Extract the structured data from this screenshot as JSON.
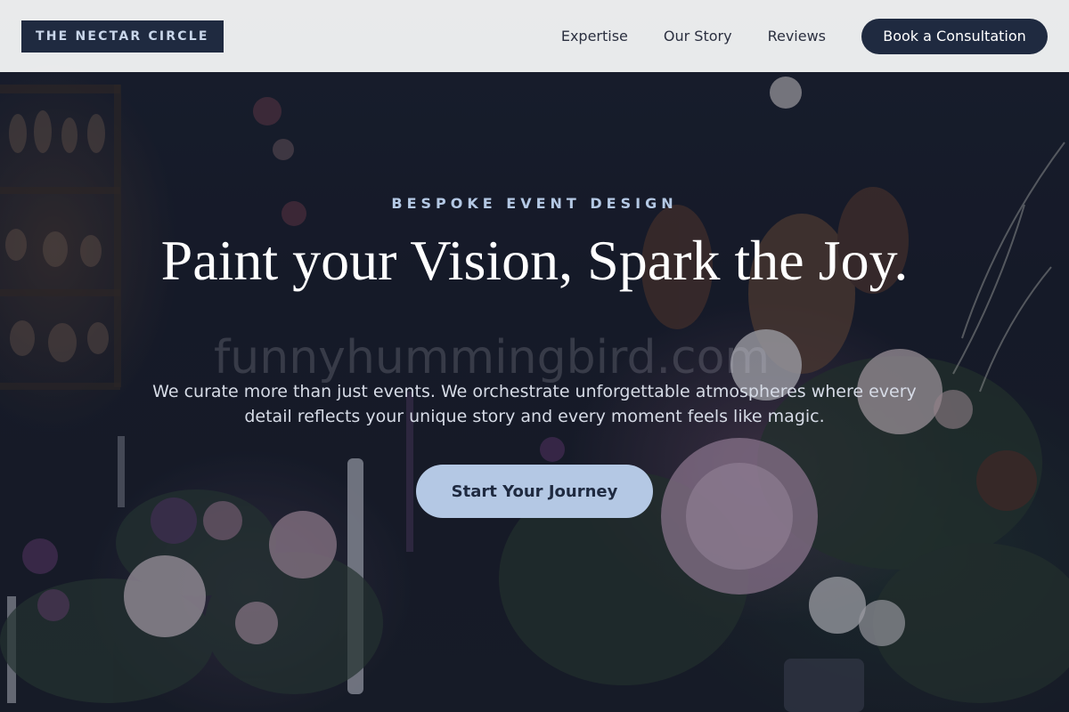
{
  "brand": {
    "logo_text": "THE NECTAR CIRCLE"
  },
  "nav": {
    "links": [
      {
        "label": "Expertise"
      },
      {
        "label": "Our Story"
      },
      {
        "label": "Reviews"
      }
    ],
    "cta_label": "Book a Consultation"
  },
  "hero": {
    "eyebrow": "BESPOKE EVENT DESIGN",
    "headline": "Paint your Vision, Spark the Joy.",
    "subtext": "We curate more than just events. We orchestrate unforgettable atmospheres where every detail reflects your unique story and every moment feels like magic.",
    "cta_label": "Start Your Journey",
    "watermark": "funnyhummingbird.com",
    "background_image": "dark floral arrangement with candles"
  },
  "colors": {
    "navy": "#1f2a40",
    "accent_light_blue": "#b4c8e4",
    "nav_background": "#f1f2f4",
    "white": "#ffffff"
  }
}
